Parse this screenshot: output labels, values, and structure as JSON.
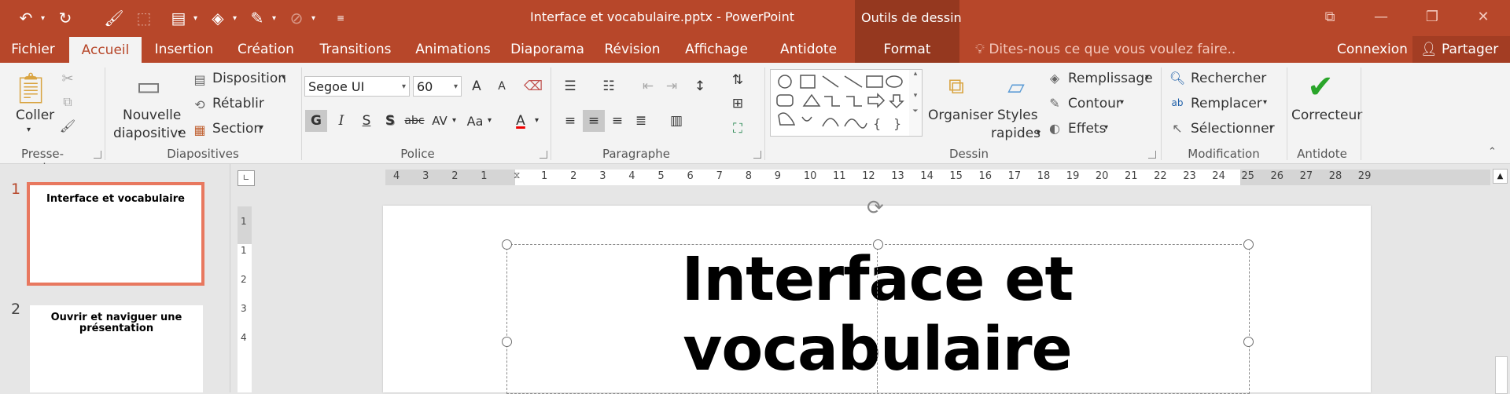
{
  "titlebar": {
    "document_title": "Interface et vocabulaire.pptx - PowerPoint",
    "contextual_title": "Outils de dessin",
    "qat": [
      "undo-icon",
      "redo-icon",
      "format-painter-icon",
      "select-shapes-icon",
      "layout-icon",
      "fill-icon",
      "pen-icon",
      "effects-icon",
      "customize-icon"
    ],
    "window_controls": [
      "ribbon-display-icon",
      "minimize-icon",
      "restore-icon",
      "close-icon"
    ],
    "colors": {
      "brand": "#b7472a",
      "contextual": "#95381f",
      "selection": "#e8785f"
    }
  },
  "tabs": {
    "file": "Fichier",
    "items": [
      "Accueil",
      "Insertion",
      "Création",
      "Transitions",
      "Animations",
      "Diaporama",
      "Révision",
      "Affichage",
      "Antidote",
      "Format"
    ],
    "active": "Accueil",
    "tell_me": "Dites-nous ce que vous voulez faire..",
    "sign_in": "Connexion",
    "share": "Partager"
  },
  "ribbon": {
    "clipboard": {
      "paste": "Coller",
      "label": "Presse-papiers"
    },
    "slides": {
      "new_slide_1": "Nouvelle",
      "new_slide_2": "diapositive",
      "layout": "Disposition",
      "reset": "Rétablir",
      "section": "Section",
      "label": "Diapositives"
    },
    "font": {
      "name": "Segoe UI",
      "size": "60",
      "bold": "G",
      "italic": "I",
      "underline": "S",
      "shadow": "S",
      "strike": "abc",
      "spacing": "AV",
      "case": "Aa",
      "color": "A",
      "grow": "A",
      "shrink": "A",
      "label": "Police"
    },
    "paragraph": {
      "label": "Paragraphe"
    },
    "drawing": {
      "arrange": "Organiser",
      "quick_styles_1": "Styles",
      "quick_styles_2": "rapides",
      "fill": "Remplissage",
      "outline": "Contour",
      "effects": "Effets",
      "label": "Dessin"
    },
    "editing": {
      "find": "Rechercher",
      "replace": "Remplacer",
      "select": "Sélectionner",
      "label": "Modification"
    },
    "antidote": {
      "corrector": "Correcteur",
      "label": "Antidote"
    }
  },
  "slides_panel": [
    {
      "number": "1",
      "title": "Interface et vocabulaire",
      "selected": true
    },
    {
      "number": "2",
      "title_line1": "Ouvrir et naviguer  une",
      "title_line2": "présentation",
      "selected": false
    }
  ],
  "ruler": {
    "h_left": [
      "4",
      "3",
      "2",
      "1"
    ],
    "h_right": [
      "1",
      "2",
      "3",
      "4",
      "5",
      "6",
      "7",
      "8",
      "9",
      "10",
      "11",
      "12",
      "13",
      "14",
      "15",
      "16",
      "17",
      "18",
      "19",
      "20",
      "21",
      "22",
      "23",
      "24",
      "25",
      "26",
      "27",
      "28",
      "29"
    ],
    "v": [
      "1",
      "1",
      "2",
      "3",
      "4"
    ]
  },
  "slide": {
    "title": "Interface et vocabulaire"
  }
}
